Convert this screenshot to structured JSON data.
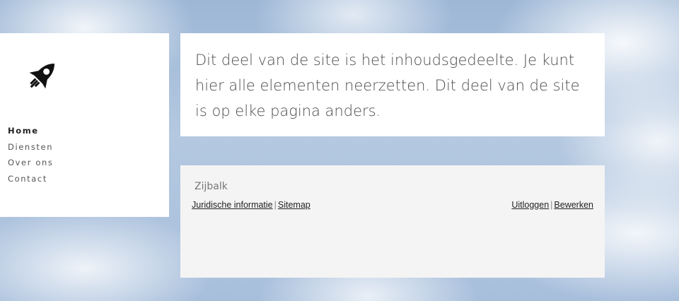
{
  "logo": {
    "icon": "rocket-icon",
    "color": "#111111"
  },
  "nav": {
    "items": [
      {
        "label": "Home",
        "active": true
      },
      {
        "label": "Diensten",
        "active": false
      },
      {
        "label": "Over ons",
        "active": false
      },
      {
        "label": "Contact",
        "active": false
      }
    ]
  },
  "content": {
    "text": "Dit deel van de site is het inhoudsgedeelte. Je kunt hier alle elementen neerzetten. Dit deel van de site is op elke pagina anders."
  },
  "sidebar_box": {
    "title": "Zijbalk",
    "separator": "|",
    "left_links": [
      "Juridische informatie",
      "Sitemap"
    ],
    "right_links": [
      "Uitloggen",
      "Bewerken"
    ]
  }
}
